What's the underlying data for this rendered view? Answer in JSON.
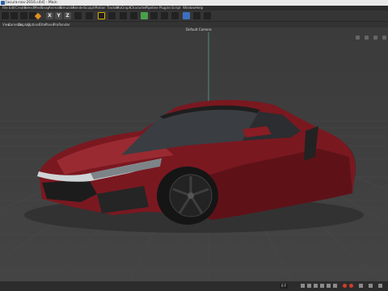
{
  "window": {
    "title": "[acura-nsx-2016.c4d] - Main"
  },
  "menubar": {
    "items": [
      "File",
      "Edit",
      "Create",
      "Select",
      "Mesh",
      "Snap",
      "Animate",
      "Simulate",
      "Render",
      "Sculpt",
      "Motion Tracker",
      "MoGraph",
      "Character",
      "Pipeline",
      "Plugins",
      "Script",
      "Window",
      "Help"
    ]
  },
  "toolbar": {
    "axis_labels": [
      "X",
      "Y",
      "Z"
    ]
  },
  "viewport_menu": {
    "items": [
      "View",
      "Cameras",
      "Display",
      "Options",
      "Filter",
      "Panel",
      "ProRender"
    ]
  },
  "viewport": {
    "camera_label": "Default Camera",
    "object": "sports-car",
    "colors": {
      "body": "#7a1820",
      "background": "#3d3d3d",
      "grid": "#4a4a4a",
      "axis": "#5aa08c"
    }
  },
  "timeline": {
    "frame_field": "0 F"
  }
}
